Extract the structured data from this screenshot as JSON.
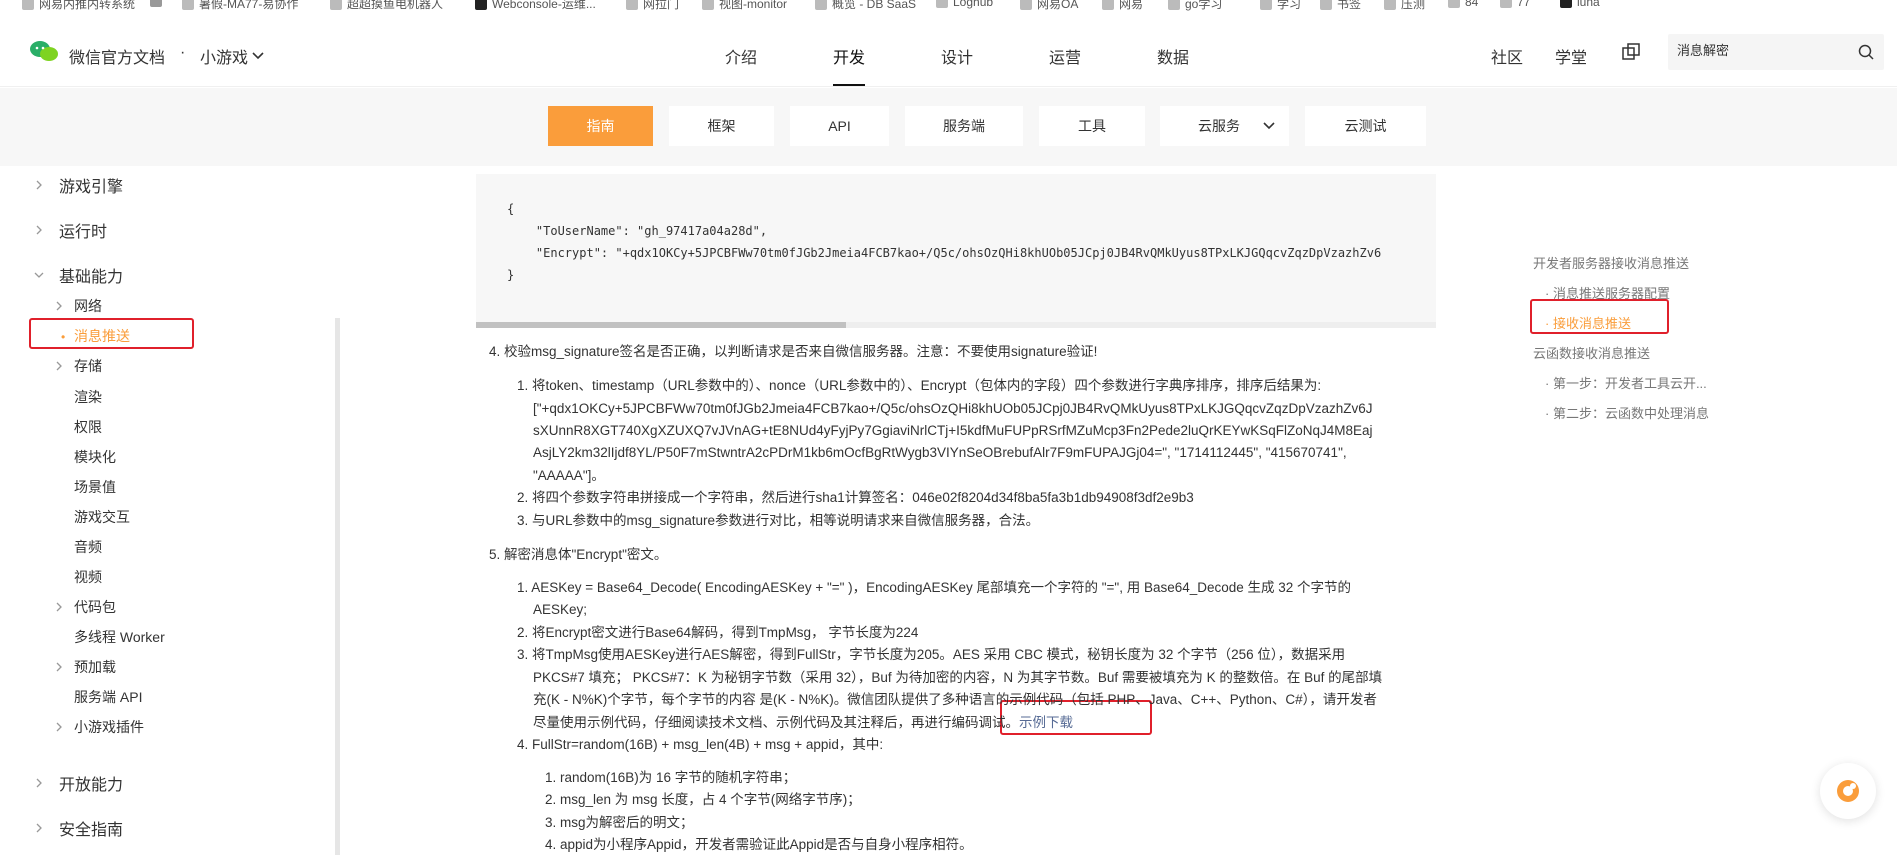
{
  "bookmarks": [
    "网易内推内转系统",
    "暑假-MA77-易协作",
    "超超摸鱼电机器人",
    "Webconsole-运维...",
    "网拉门",
    "视图-monitor",
    "概览 - DB SaaS",
    "Loghub",
    "网易OA",
    "网易",
    "go学习",
    "学习",
    "书签",
    "压测",
    "84",
    "77",
    "luna"
  ],
  "header": {
    "brand": "微信官方文档",
    "dot": "·",
    "product": "小游戏",
    "nav": [
      "介绍",
      "开发",
      "设计",
      "运营",
      "数据"
    ],
    "right_nav": [
      "社区",
      "学堂"
    ],
    "search_value": "消息解密"
  },
  "tabs": [
    {
      "label": "指南"
    },
    {
      "label": "框架"
    },
    {
      "label": "API"
    },
    {
      "label": "服务端"
    },
    {
      "label": "工具"
    },
    {
      "label": "云服务"
    },
    {
      "label": "云测试"
    }
  ],
  "sidebar": {
    "top_items": [
      "游戏引擎",
      "运行时",
      "基础能力"
    ],
    "sub_items": [
      "网络",
      "消息推送",
      "存储",
      "渲染",
      "权限",
      "模块化",
      "场景值",
      "游戏交互",
      "音频",
      "视频",
      "代码包",
      "多线程 Worker",
      "预加载",
      "服务端 API",
      "小游戏插件"
    ],
    "bottom_items": [
      "开放能力",
      "安全指南"
    ]
  },
  "code": {
    "open": "{",
    "line1": "    \"ToUserName\": \"gh_97417a04a28d\",",
    "line2": "    \"Encrypt\": \"+qdx1OKCy+5JPCBFWw70tm0fJGb2Jmeia4FCB7kao+/Q5c/ohsOzQHi8khUOb05JCpj0JB4RvQMkUyus8TPxLKJGQqcvZqzDpVzazhZv6",
    "close": "}"
  },
  "content": {
    "step4_title": "4. 校验msg_signature签名是否正确，以判断请求是否来自微信服务器。注意：不要使用signature验证!",
    "step4_1a": "1. 将token、timestamp（URL参数中的）、nonce（URL参数中的）、Encrypt（包体内的字段）四个参数进行字典序排序，排序后结果为:",
    "step4_1b": "[\"+qdx1OKCy+5JPCBFWw70tm0fJGb2Jmeia4FCB7kao+/Q5c/ohsOzQHi8khUOb05JCpj0JB4RvQMkUyus8TPxLKJGQqcvZqzDpVzazhZv6J",
    "step4_1c": "sXUnnR8XGT740XgXZUXQ7vJVnAG+tE8NUd4yFyjPy7GgiaviNrlCTj+I5kdfMuFUPpRSrfMZuMcp3Fn2Pede2luQrKEYwKSqFlZoNqJ4M8Eaj",
    "step4_1d": "AsjLY2km32lIjdf8YL/P50F7mStwntrA2cPDrM1kb6mOcfBgRtWygb3VIYnSeOBrebufAlr7F9mFUPAJGj04=\", \"1714112445\", \"415670741\",",
    "step4_1e": "\"AAAAA\"]。",
    "step4_2": "2. 将四个参数字符串拼接成一个字符串，然后进行sha1计算签名：046e02f8204d34f8ba5fa3b1db94908f3df2e9b3",
    "step4_3": "3. 与URL参数中的msg_signature参数进行对比，相等说明请求来自微信服务器，合法。",
    "step5_title": "5. 解密消息体\"Encrypt\"密文。",
    "step5_1a": "1. AESKey = Base64_Decode( EncodingAESKey + \"=\" )，EncodingAESKey 尾部填充一个字符的 \"=\", 用 Base64_Decode 生成 32 个字节的",
    "step5_1b": "AESKey;",
    "step5_2": "2. 将Encrypt密文进行Base64解码，得到TmpMsg， 字节长度为224",
    "step5_3a": "3. 将TmpMsg使用AESKey进行AES解密，得到FullStr，字节长度为205。AES 采用 CBC 模式，秘钥长度为 32 个字节（256 位），数据采用",
    "step5_3b": "PKCS#7 填充； PKCS#7：K 为秘钥字节数（采用 32），Buf 为待加密的内容，N 为其字节数。Buf 需要被填充为 K 的整数倍。在 Buf 的尾部填",
    "step5_3c": "充(K - N%K)个字节，每个字节的内容 是(K - N%K)。微信团队提供了多种语言的示例代码（包括 PHP、Java、C++、Python、C#），请开发者",
    "step5_3d": "尽量使用示例代码，仔细阅读技术文档、示例代码及其注释后，再进行编码调试。",
    "step5_3_link": "示例下载",
    "step5_4": "4. FullStr=random(16B) + msg_len(4B) + msg + appid，其中:",
    "step5_4_1": "1. random(16B)为 16 字节的随机字符串；",
    "step5_4_2": "2. msg_len 为 msg 长度，占 4 个字节(网络字节序)；",
    "step5_4_3": "3. msg为解密后的明文；",
    "step5_4_4": "4. appid为小程序Appid，开发者需验证此Appid是否与自身小程序相符。"
  },
  "toc": {
    "h1": "开发者服务器接收消息推送",
    "h1_1": "· 消息推送服务器配置",
    "h1_2": "· 接收消息推送",
    "h2": "云函数接收消息推送",
    "h2_1": "· 第一步：开发者工具云开...",
    "h2_2": "· 第二步：云函数中处理消息"
  },
  "colors": {
    "accent": "#fa9d3b",
    "highlight_box": "#e0202b",
    "link": "#576b95"
  }
}
